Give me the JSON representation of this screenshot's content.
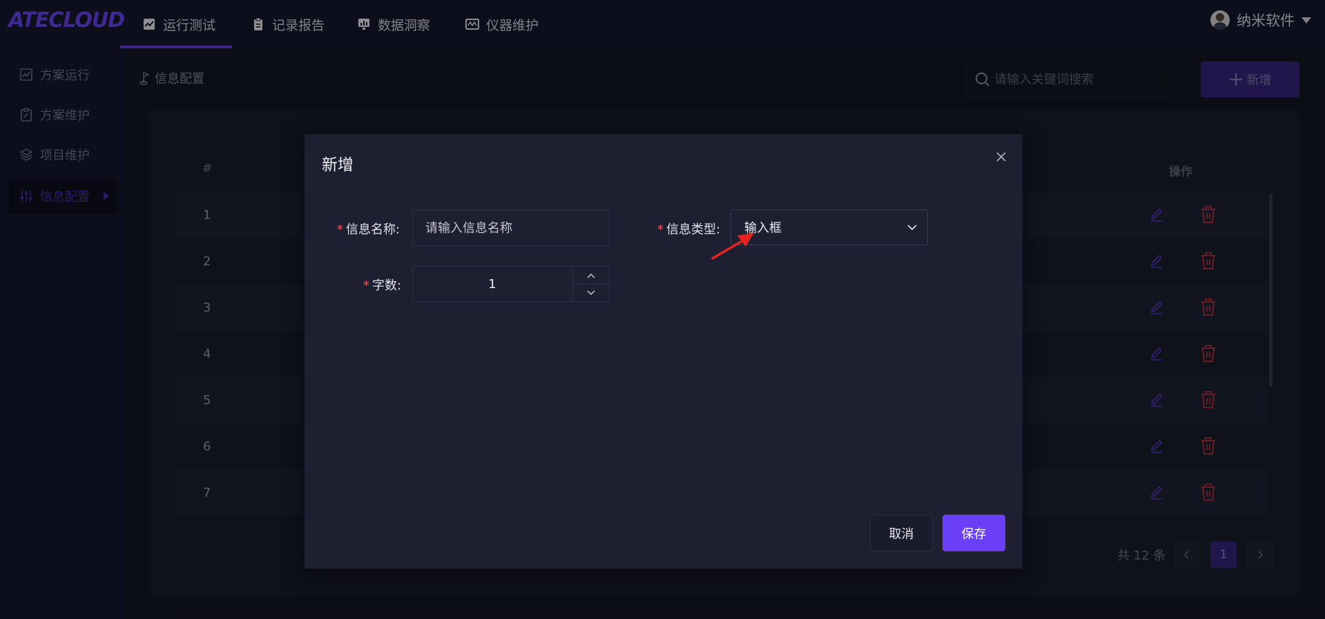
{
  "app": {
    "logo": "ATECLOUD",
    "nav": [
      {
        "label": "运行测试",
        "icon": "trend-chart-icon",
        "active": true
      },
      {
        "label": "记录报告",
        "icon": "clipboard-icon",
        "active": false
      },
      {
        "label": "数据洞察",
        "icon": "monitor-chart-icon",
        "active": false
      },
      {
        "label": "仪器维护",
        "icon": "instrument-icon",
        "active": false
      }
    ],
    "user": {
      "name": "纳米软件",
      "icon": "avatar-icon"
    }
  },
  "sidebar": {
    "items": [
      {
        "label": "方案运行",
        "icon": "chart-icon",
        "active": false
      },
      {
        "label": "方案维护",
        "icon": "edit-doc-icon",
        "active": false
      },
      {
        "label": "项目维护",
        "icon": "layers-icon",
        "active": false
      },
      {
        "label": "信息配置",
        "icon": "sliders-icon",
        "active": true
      }
    ]
  },
  "page": {
    "breadcrumb": "信息配置",
    "search_placeholder": "请输入关键词搜索",
    "add_label": "新增"
  },
  "table": {
    "headers": {
      "index": "#",
      "actions": "操作"
    },
    "rows": [
      "1",
      "2",
      "3",
      "4",
      "5",
      "6",
      "7"
    ]
  },
  "pagination": {
    "total_text": "共 12 条",
    "current_page": "1",
    "prev_icon": "chevron-left-icon",
    "next_icon": "chevron-right-icon"
  },
  "dialog": {
    "title": "新增",
    "name_label": "信息名称:",
    "name_placeholder": "请输入信息名称",
    "type_label": "信息类型:",
    "type_value": "输入框",
    "count_label": "字数:",
    "count_value": "1",
    "required_mark": "*",
    "cancel_label": "取消",
    "save_label": "保存"
  },
  "colors": {
    "accent": "#6a3ff5",
    "danger": "#c0303a",
    "edit": "#5a3ad0",
    "annotation_arrow": "#e8231f"
  }
}
